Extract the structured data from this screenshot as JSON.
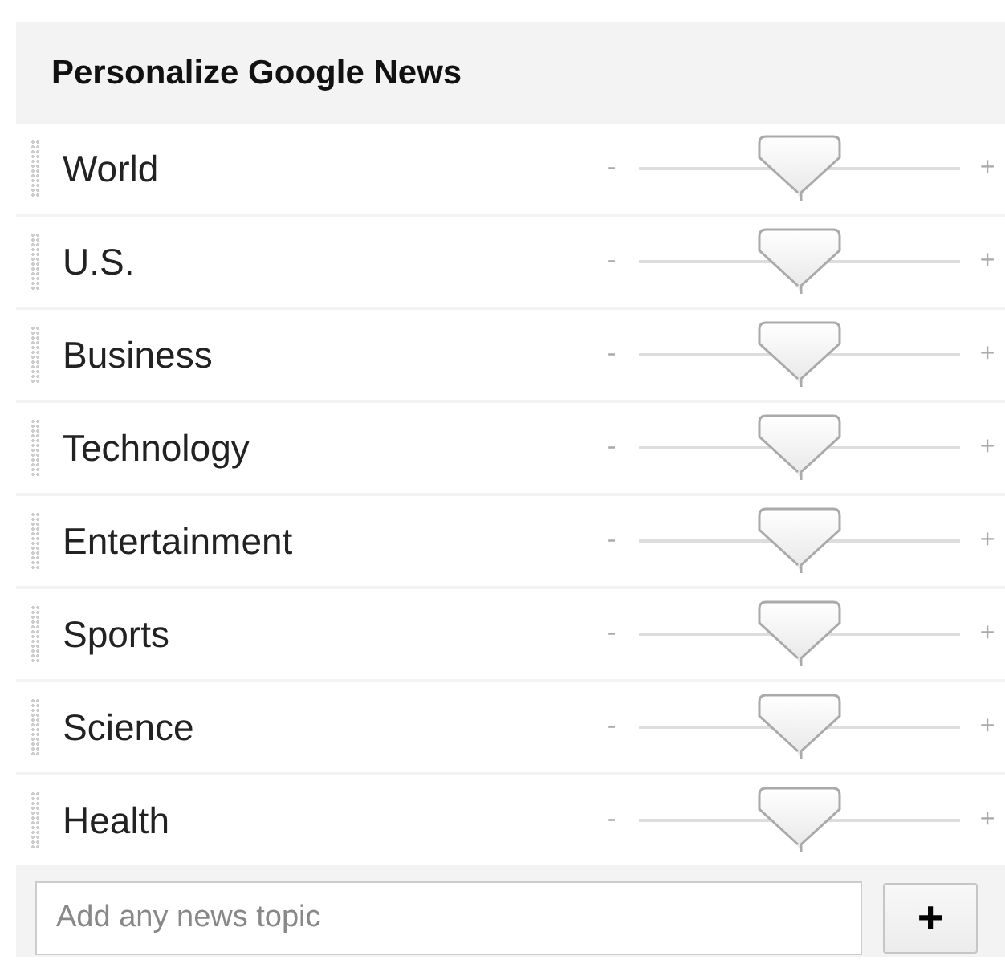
{
  "title": "Personalize Google News",
  "sections": [
    {
      "name": "World",
      "level": 0.5,
      "minus": "-",
      "plus": "+"
    },
    {
      "name": "U.S.",
      "level": 0.5,
      "minus": "-",
      "plus": "+"
    },
    {
      "name": "Business",
      "level": 0.5,
      "minus": "-",
      "plus": "+"
    },
    {
      "name": "Technology",
      "level": 0.5,
      "minus": "-",
      "plus": "+"
    },
    {
      "name": "Entertainment",
      "level": 0.5,
      "minus": "-",
      "plus": "+"
    },
    {
      "name": "Sports",
      "level": 0.5,
      "minus": "-",
      "plus": "+"
    },
    {
      "name": "Science",
      "level": 0.5,
      "minus": "-",
      "plus": "+"
    },
    {
      "name": "Health",
      "level": 0.5,
      "minus": "-",
      "plus": "+"
    }
  ],
  "topic": {
    "placeholder": "Add any news topic",
    "button": "+"
  }
}
